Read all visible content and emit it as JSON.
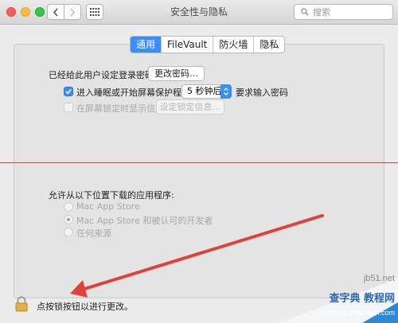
{
  "window": {
    "title": "安全性与隐私"
  },
  "search": {
    "placeholder": "搜索"
  },
  "tabs": [
    {
      "label": "通用",
      "active": true
    },
    {
      "label": "FileVault",
      "active": false
    },
    {
      "label": "防火墙",
      "active": false
    },
    {
      "label": "隐私",
      "active": false
    }
  ],
  "general": {
    "password_label": "已经给此用户设定登录密码",
    "change_password_button": "更改密码…",
    "require_password_label": "进入睡眠或开始屏幕保护程序",
    "require_password_checked": true,
    "delay_select": "5 秒钟后",
    "require_password_suffix": "要求输入密码",
    "show_message_label": "在屏幕锁定时显示信息",
    "show_message_checked": false,
    "set_lock_message_button": "设定锁定信息…"
  },
  "downloads": {
    "heading": "允许从以下位置下载的应用程序:",
    "options": [
      {
        "label": "Mac App Store",
        "selected": false
      },
      {
        "label": "Mac App Store 和被认可的开发者",
        "selected": true
      },
      {
        "label": "任何来源",
        "selected": false
      }
    ]
  },
  "footer": {
    "lock_label": "点按锁按钮以进行更改。"
  },
  "watermark": {
    "line1": "jb51.net",
    "line2": "查字典 教程网",
    "line3": "jiaocheng.chazidian.com"
  },
  "colors": {
    "accent": "#3a8ef7",
    "annotation": "#e0423b"
  }
}
